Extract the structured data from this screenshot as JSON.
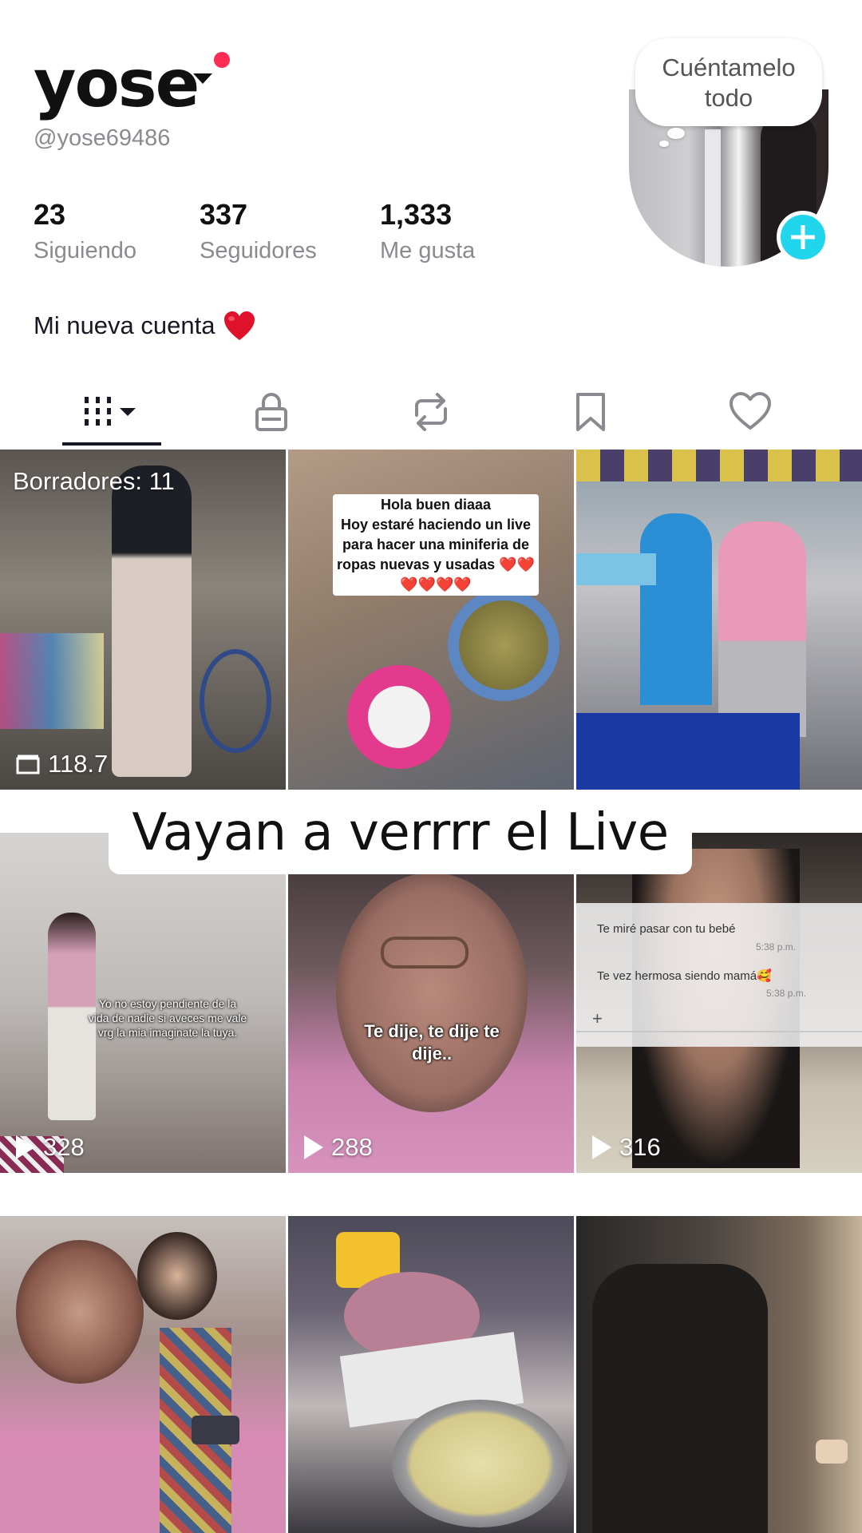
{
  "profile": {
    "username": "yose",
    "handle": "@yose69486",
    "bio": "Mi nueva cuenta",
    "bubble_text": "Cuéntamelo todo",
    "stats": [
      {
        "num": "23",
        "label": "Siguiendo"
      },
      {
        "num": "337",
        "label": "Seguidores"
      },
      {
        "num": "1,333",
        "label": "Me gusta"
      }
    ]
  },
  "tabs": [
    {
      "icon": "grid-icon",
      "active": true
    },
    {
      "icon": "lock-icon",
      "active": false
    },
    {
      "icon": "repost-icon",
      "active": false
    },
    {
      "icon": "bookmark-icon",
      "active": false
    },
    {
      "icon": "heart-icon",
      "active": false
    }
  ],
  "videos": [
    {
      "drafts_label": "Borradores: 11",
      "views": "118.7"
    },
    {
      "caption": "Hola buen diaaa\nHoy estaré haciendo un live\npara hacer una miniferia de\nropas nuevas y usadas ❤️❤️\n❤️❤️❤️❤️"
    },
    {
      "views": ""
    },
    {
      "caption": "Yo no estoy pendiente de la vida de nadie si aveces me vale vrg la mia imaginate la tuya.",
      "views": "328"
    },
    {
      "caption": "Te dije, te dije te dije..",
      "views": "288"
    },
    {
      "chat": [
        "Te miré pasar con tu bebé",
        "Te vez hermosa siendo mamá🥰"
      ],
      "chat_times": [
        "5:38 p.m.",
        "5:38 p.m."
      ],
      "views": "316"
    },
    {
      "views": ""
    },
    {
      "views": ""
    },
    {
      "views": ""
    }
  ],
  "live_banner": "Vayan a verrrr el Live",
  "colors": {
    "accent": "#fe2c55",
    "add_button": "#20d5ec",
    "text": "#161823",
    "muted": "#8a8b91"
  }
}
